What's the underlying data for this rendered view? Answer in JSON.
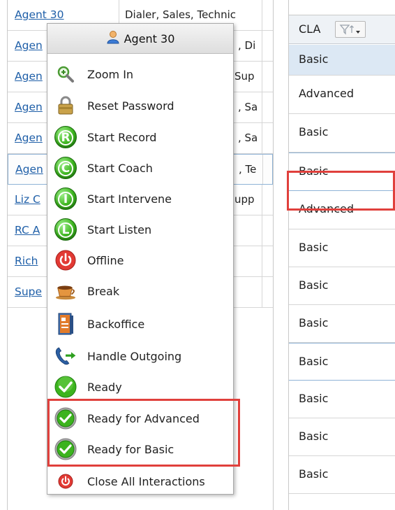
{
  "grid": {
    "rows": [
      {
        "name": "Agent 30",
        "skills": "Dialer, Sales, Technic"
      },
      {
        "name": "Agen",
        "skills": ", Di"
      },
      {
        "name": "Agen",
        "skills": "Sup"
      },
      {
        "name": "Agen",
        "skills": ", Sa"
      },
      {
        "name": "Agen",
        "skills": ", Sa"
      },
      {
        "name": "Agen",
        "skills": ", Te"
      },
      {
        "name": "Liz C",
        "skills": "upp"
      },
      {
        "name": "RC A",
        "skills": ""
      },
      {
        "name": "Rich",
        "skills": ""
      },
      {
        "name": "Supe",
        "skills": ""
      }
    ]
  },
  "context_menu": {
    "header": {
      "title": "Agent 30",
      "icon": "user-icon"
    },
    "items": [
      {
        "label": "Zoom In",
        "icon": "zoom-in-icon"
      },
      {
        "label": "Reset Password",
        "icon": "lock-icon"
      },
      {
        "label": "Start Record",
        "icon": "record-icon",
        "letter": "R"
      },
      {
        "label": "Start Coach",
        "icon": "coach-icon",
        "letter": "C"
      },
      {
        "label": "Start Intervene",
        "icon": "intervene-icon",
        "letter": "I"
      },
      {
        "label": "Start Listen",
        "icon": "listen-icon",
        "letter": "L"
      },
      {
        "label": "Offline",
        "icon": "power-icon"
      },
      {
        "label": "Break",
        "icon": "coffee-cup-icon"
      },
      {
        "label": "Backoffice",
        "icon": "backoffice-icon"
      },
      {
        "label": "Handle Outgoing",
        "icon": "outgoing-call-icon"
      },
      {
        "label": "Ready",
        "icon": "ready-check-icon"
      },
      {
        "label": "Ready for Advanced",
        "icon": "ready-check-icon"
      },
      {
        "label": "Ready for Basic",
        "icon": "ready-check-icon"
      },
      {
        "label": "Close All Interactions",
        "icon": "close-all-power-icon"
      }
    ]
  },
  "cla": {
    "header": "CLA",
    "filter_icon": "filter-sort-icon",
    "rows": [
      "Basic",
      "Advanced",
      "Basic",
      "Basic",
      "Advanced",
      "Basic",
      "Basic",
      "Basic",
      "Basic",
      "Basic",
      "Basic",
      "Basic"
    ]
  },
  "colors": {
    "link": "#1f5fa8",
    "highlight": "#e0403c",
    "ready_green": "#3cb31e",
    "offline_red": "#d9302b"
  }
}
